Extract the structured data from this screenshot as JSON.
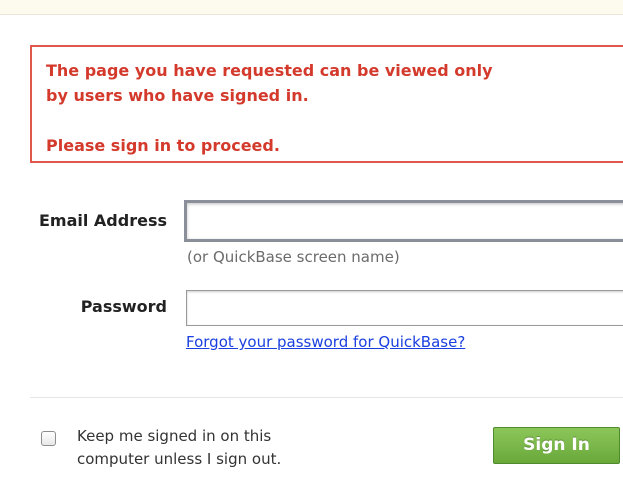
{
  "error": {
    "line1": "The page you have requested can be viewed only",
    "line2": "by users who have signed in.",
    "line3": "Please sign in to proceed."
  },
  "form": {
    "email_label": "Email Address",
    "email_value": "",
    "email_hint": "(or QuickBase screen name)",
    "password_label": "Password",
    "password_value": "",
    "forgot_link": "Forgot your password for QuickBase?"
  },
  "footer": {
    "keep_line1": "Keep me signed in on this",
    "keep_line2": "computer unless I sign out.",
    "keep_checked": false,
    "signin_label": "Sign In"
  },
  "colors": {
    "error_text": "#d43a2c",
    "error_border": "#e0584c",
    "link": "#1a3fe0",
    "button_green": "#6aa83a"
  }
}
